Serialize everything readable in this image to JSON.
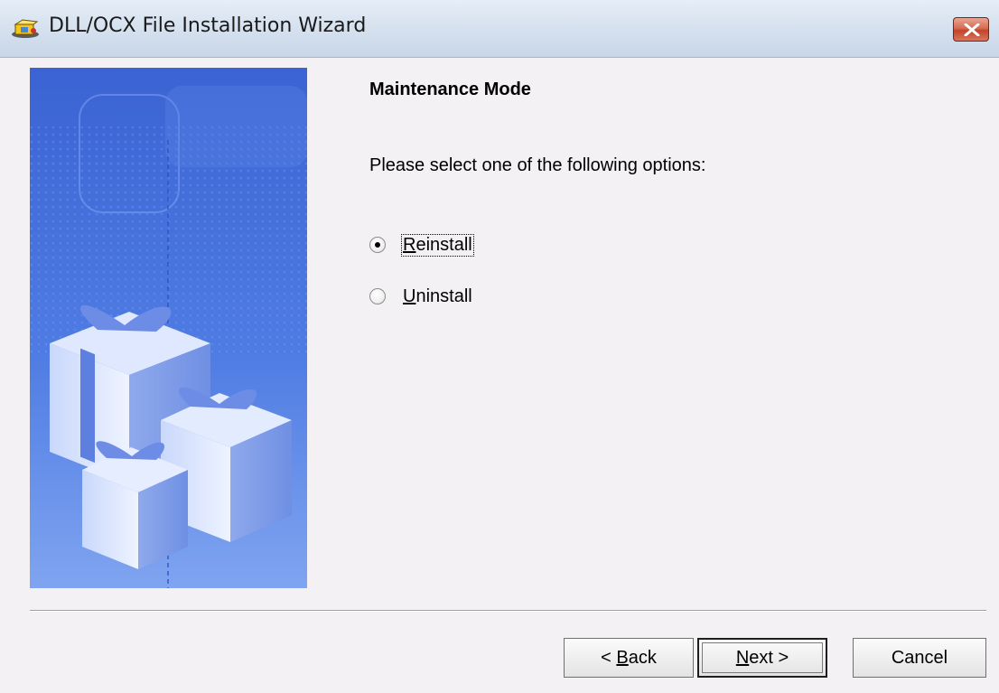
{
  "window": {
    "title": "DLL/OCX File Installation Wizard",
    "icon": "installer-box-icon",
    "close_icon": "close-icon"
  },
  "content": {
    "heading": "Maintenance Mode",
    "prompt": "Please select one of the following options:",
    "options": [
      {
        "label_key": "R",
        "label_rest": "einstall",
        "selected": true
      },
      {
        "label_key": "U",
        "label_rest": "ninstall",
        "selected": false
      }
    ]
  },
  "buttons": {
    "back_prefix": "< ",
    "back_key": "B",
    "back_rest": "ack",
    "next_key": "N",
    "next_rest": "ext >",
    "cancel": "Cancel"
  },
  "colors": {
    "banner_blue": "#3d67d6",
    "window_bg": "#f3f1f3",
    "titlebar": "#d4e0ee",
    "close_red": "#c2452a"
  }
}
